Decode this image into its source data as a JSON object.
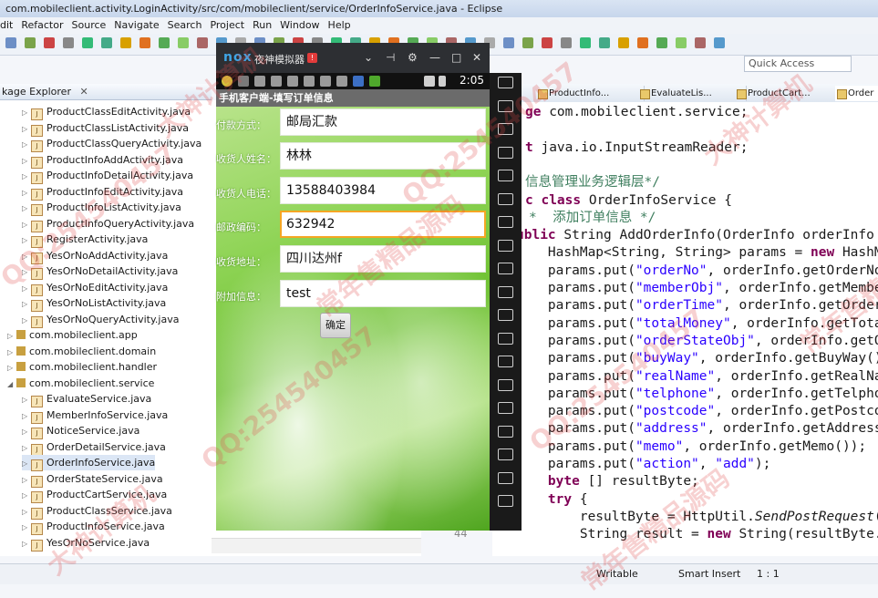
{
  "window": {
    "title": "com.mobileclient.activity.LoginActivity/src/com/mobileclient/service/OrderInfoService.java - Eclipse"
  },
  "menu": [
    "dit",
    "Refactor",
    "Source",
    "Navigate",
    "Search",
    "Project",
    "Run",
    "Window",
    "Help"
  ],
  "quick_access": "Quick Access",
  "package_explorer": {
    "tab_label": "kage Explorer",
    "close_glyph": "✕",
    "items": [
      {
        "label": "ProductClassEditActivity.java",
        "kind": "file"
      },
      {
        "label": "ProductClassListActivity.java",
        "kind": "file"
      },
      {
        "label": "ProductClassQueryActivity.java",
        "kind": "file"
      },
      {
        "label": "ProductInfoAddActivity.java",
        "kind": "file"
      },
      {
        "label": "ProductInfoDetailActivity.java",
        "kind": "file"
      },
      {
        "label": "ProductInfoEditActivity.java",
        "kind": "file"
      },
      {
        "label": "ProductInfoListActivity.java",
        "kind": "file"
      },
      {
        "label": "ProductInfoQueryActivity.java",
        "kind": "file"
      },
      {
        "label": "RegisterActivity.java",
        "kind": "file"
      },
      {
        "label": "YesOrNoAddActivity.java",
        "kind": "file"
      },
      {
        "label": "YesOrNoDetailActivity.java",
        "kind": "file"
      },
      {
        "label": "YesOrNoEditActivity.java",
        "kind": "file"
      },
      {
        "label": "YesOrNoListActivity.java",
        "kind": "file"
      },
      {
        "label": "YesOrNoQueryActivity.java",
        "kind": "file"
      },
      {
        "label": "com.mobileclient.app",
        "kind": "package"
      },
      {
        "label": "com.mobileclient.domain",
        "kind": "package"
      },
      {
        "label": "com.mobileclient.handler",
        "kind": "package"
      },
      {
        "label": "com.mobileclient.service",
        "kind": "package-open"
      },
      {
        "label": "EvaluateService.java",
        "kind": "file"
      },
      {
        "label": "MemberInfoService.java",
        "kind": "file"
      },
      {
        "label": "NoticeService.java",
        "kind": "file"
      },
      {
        "label": "OrderDetailService.java",
        "kind": "file"
      },
      {
        "label": "OrderInfoService.java",
        "kind": "file-selected"
      },
      {
        "label": "OrderStateService.java",
        "kind": "file"
      },
      {
        "label": "ProductCartService.java",
        "kind": "file"
      },
      {
        "label": "ProductClassService.java",
        "kind": "file"
      },
      {
        "label": "ProductInfoService.java",
        "kind": "file"
      },
      {
        "label": "YesOrNoService.java",
        "kind": "file"
      }
    ]
  },
  "editor": {
    "tabs": [
      "ProductInfo...",
      "EvaluateLis...",
      "ProductCart...",
      "Order"
    ],
    "code_lines": [
      {
        "parts": [
          [
            "kw",
            "ge"
          ],
          [
            "",
            "com.mobileclient.service;"
          ]
        ]
      },
      {
        "parts": []
      },
      {
        "parts": [
          [
            "kw",
            "t"
          ],
          [
            "",
            "java.io.InputStreamReader;"
          ]
        ]
      },
      {
        "parts": []
      },
      {
        "parts": [
          [
            "cm",
            "信息管理业务逻辑层*/"
          ]
        ]
      },
      {
        "parts": [
          [
            "kw",
            "c class"
          ],
          [
            "",
            "OrderInfoService {"
          ]
        ]
      },
      {
        "parts": [
          [
            "cm",
            "*  添加订单信息 */"
          ]
        ]
      },
      {
        "parts": [
          [
            "kw",
            "ublic"
          ],
          [
            "",
            "String AddOrderInfo(OrderInfo orderInfo"
          ]
        ]
      },
      {
        "parts": [
          [
            "",
            "    HashMap<String, String> params = "
          ],
          [
            "kw",
            "new"
          ],
          [
            "",
            " HashM"
          ]
        ]
      },
      {
        "parts": [
          [
            "",
            "    params.put("
          ],
          [
            "st",
            "\"orderNo\""
          ],
          [
            "",
            ", orderInfo.getOrderNo"
          ]
        ]
      },
      {
        "parts": [
          [
            "",
            "    params.put("
          ],
          [
            "st",
            "\"memberObj\""
          ],
          [
            "",
            ", orderInfo.getMember"
          ]
        ]
      },
      {
        "parts": [
          [
            "",
            "    params.put("
          ],
          [
            "st",
            "\"orderTime\""
          ],
          [
            "",
            ", orderInfo.getOrder"
          ]
        ]
      },
      {
        "parts": [
          [
            "",
            "    params.put("
          ],
          [
            "st",
            "\"totalMoney\""
          ],
          [
            "",
            ", orderInfo.getTota"
          ]
        ]
      },
      {
        "parts": [
          [
            "",
            "    params.put("
          ],
          [
            "st",
            "\"orderStateObj\""
          ],
          [
            "",
            ", orderInfo.getO"
          ]
        ]
      },
      {
        "parts": [
          [
            "",
            "    params.put("
          ],
          [
            "st",
            "\"buyWay\""
          ],
          [
            "",
            ", orderInfo.getBuyWay()"
          ]
        ]
      },
      {
        "parts": [
          [
            "",
            "    params.put("
          ],
          [
            "st",
            "\"realName\""
          ],
          [
            "",
            ", orderInfo.getRealNa"
          ]
        ]
      },
      {
        "parts": [
          [
            "",
            "    params.put("
          ],
          [
            "st",
            "\"telphone\""
          ],
          [
            "",
            ", orderInfo.getTelpho"
          ]
        ]
      },
      {
        "parts": [
          [
            "",
            "    params.put("
          ],
          [
            "st",
            "\"postcode\""
          ],
          [
            "",
            ", orderInfo.getPostco"
          ]
        ]
      },
      {
        "parts": [
          [
            "",
            "    params.put("
          ],
          [
            "st",
            "\"address\""
          ],
          [
            "",
            ", orderInfo.getAddress"
          ]
        ]
      },
      {
        "parts": [
          [
            "",
            "    params.put("
          ],
          [
            "st",
            "\"memo\""
          ],
          [
            "",
            ", orderInfo.getMemo());"
          ]
        ]
      },
      {
        "parts": [
          [
            "",
            "    params.put("
          ],
          [
            "st",
            "\"action\""
          ],
          [
            "",
            ", "
          ],
          [
            "st",
            "\"add\""
          ],
          [
            "",
            ");"
          ]
        ]
      },
      {
        "parts": [
          [
            "",
            "    "
          ],
          [
            "kw",
            "byte"
          ],
          [
            "",
            "[] resultByte;"
          ]
        ]
      },
      {
        "parts": [
          [
            "",
            "    "
          ],
          [
            "kw",
            "try"
          ],
          [
            "",
            " {"
          ]
        ]
      },
      {
        "parts": [
          [
            "",
            "        resultByte = HttpUtil."
          ],
          [
            "it",
            "SendPostRequest"
          ],
          [
            "",
            "("
          ]
        ]
      },
      {
        "parts": [
          [
            "",
            "        String result = "
          ],
          [
            "kw",
            "new"
          ],
          [
            "",
            " String(resultByte."
          ]
        ]
      }
    ],
    "line_number": "44"
  },
  "status": {
    "writable": "Writable",
    "insert": "Smart Insert",
    "position": "1 : 1"
  },
  "emulator": {
    "logo": "nox",
    "name": "夜神模拟器",
    "badge": "!",
    "clock": "2:05",
    "controls": [
      "⌄",
      "⊣",
      "⚙",
      "—",
      "□",
      "✕"
    ],
    "app_title": "手机客户端-填写订单信息",
    "form": [
      {
        "label": "付款方式：",
        "value": "邮局汇款",
        "focused": false
      },
      {
        "label": "收货人姓名：",
        "value": "林林",
        "focused": false
      },
      {
        "label": "收货人电话：",
        "value": "13588403984",
        "focused": false
      },
      {
        "label": "邮政编码：",
        "value": "632942",
        "focused": true
      },
      {
        "label": "收货地址：",
        "value": "四川达州f",
        "focused": false
      },
      {
        "label": "附加信息：",
        "value": "test",
        "focused": false
      }
    ],
    "submit_label": "确定",
    "sidebar_icons": [
      "more-icon",
      "keyboard-icon",
      "screenshot-icon",
      "scissors-icon",
      "location-icon",
      "screen-icon",
      "resize-icon",
      "volume-up-icon",
      "volume-down-icon",
      "apk-icon",
      "shake-icon",
      "multi-window-icon",
      "record-icon",
      "folder-icon",
      "menu-icon",
      "multi-instance-icon",
      "back-icon",
      "home-icon",
      "recent-icon"
    ]
  },
  "watermark": [
    "QQ:254540457",
    "大神计算机",
    "常年售精品源码"
  ],
  "colors": {
    "keyword": "#7f0055",
    "string": "#2a00ff",
    "comment": "#3f7f5f",
    "focus": "#f5a623"
  }
}
